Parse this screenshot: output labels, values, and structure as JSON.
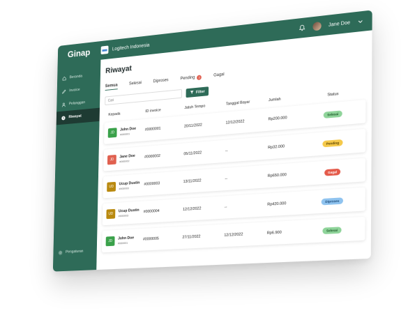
{
  "brand": "Ginap",
  "company": "Logitech Indonesia",
  "user": {
    "name": "Jane Doe"
  },
  "sidebar": {
    "items": [
      {
        "label": "Beranda",
        "icon": "home-icon"
      },
      {
        "label": "Invoice",
        "icon": "pencil-icon"
      },
      {
        "label": "Pelanggan",
        "icon": "user-icon"
      },
      {
        "label": "Riwayat",
        "icon": "clock-icon",
        "active": true
      }
    ],
    "settings": {
      "label": "Pengaturan",
      "icon": "gear-icon"
    }
  },
  "main": {
    "title": "Riwayat",
    "tabs": [
      {
        "label": "Semua",
        "active": true
      },
      {
        "label": "Selesai"
      },
      {
        "label": "Diproses"
      },
      {
        "label": "Pending",
        "badge": "3"
      },
      {
        "label": "Gagal"
      }
    ],
    "search_placeholder": "Cari",
    "filter_label": "Filter",
    "columns": [
      "Kepada",
      "ID invoice",
      "Jatuh Tempo",
      "Tanggal Bayar",
      "Jumlah",
      "Status"
    ],
    "rows": [
      {
        "initials": "JD",
        "avatar_color": "#3aa14a",
        "name": "John Doe",
        "client_id": "#000001",
        "invoice": "#0000001",
        "due": "20/11/2022",
        "paid": "12/12/2022",
        "amount": "Rp200.000",
        "status": "Selesai",
        "status_bg": "#8fd49a",
        "status_fg": "#1f5a2a"
      },
      {
        "initials": "JD",
        "avatar_color": "#e0604f",
        "name": "Jane Doe",
        "client_id": "#000002",
        "invoice": "#0000002",
        "due": "05/11/2022",
        "paid": "--",
        "amount": "Rp32.000",
        "status": "Pending",
        "status_bg": "#f5c94a",
        "status_fg": "#5a4200"
      },
      {
        "initials": "UD",
        "avatar_color": "#b9890f",
        "name": "Ucup Dustin",
        "client_id": "#000003",
        "invoice": "#0000003",
        "due": "13/11/2022",
        "paid": "--",
        "amount": "Rp650.000",
        "status": "Gagal",
        "status_bg": "#e45a4a",
        "status_fg": "#ffffff"
      },
      {
        "initials": "UD",
        "avatar_color": "#b9890f",
        "name": "Ucup Dustin",
        "client_id": "#000003",
        "invoice": "#0000004",
        "due": "12/12/2022",
        "paid": "--",
        "amount": "Rp420.000",
        "status": "Diproses",
        "status_bg": "#8fc3ef",
        "status_fg": "#1b4a78"
      },
      {
        "initials": "JD",
        "avatar_color": "#3aa14a",
        "name": "John Doe",
        "client_id": "#000001",
        "invoice": "#0000005",
        "due": "27/11/2022",
        "paid": "12/12/2022",
        "amount": "Rp6.900",
        "status": "Selesai",
        "status_bg": "#8fd49a",
        "status_fg": "#1f5a2a"
      }
    ]
  }
}
